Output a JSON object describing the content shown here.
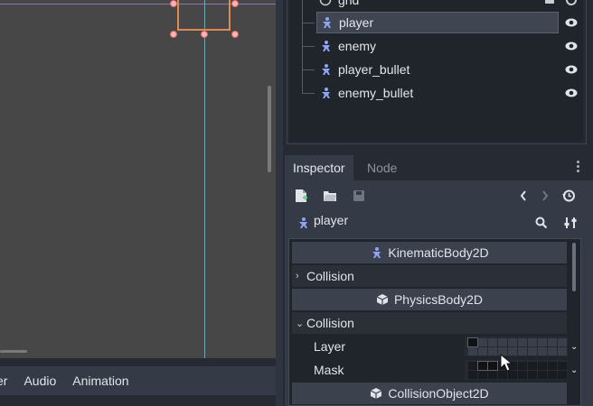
{
  "bottom_tabs": [
    "er",
    "Audio",
    "Animation"
  ],
  "scene_tree": {
    "partial_top": "grid",
    "items": [
      {
        "label": "player",
        "selected": true
      },
      {
        "label": "enemy",
        "selected": false
      },
      {
        "label": "player_bullet",
        "selected": false
      },
      {
        "label": "enemy_bullet",
        "selected": false
      }
    ]
  },
  "inspector": {
    "tabs": {
      "inspector": "Inspector",
      "node": "Node"
    },
    "object_name": "player",
    "rows": {
      "kinematic": "KinematicBody2D",
      "collision1": "Collision",
      "physics": "PhysicsBody2D",
      "collision2": "Collision",
      "layer": "Layer",
      "mask": "Mask",
      "collision_object": "CollisionObject2D"
    }
  },
  "colors": {
    "panel": "#262a33",
    "tree_bg": "#20242b",
    "viewport": "#474747",
    "accent_node": "#8da5f3",
    "selection_rect": "#e0884f"
  },
  "icons": [
    "node-kinematic-icon",
    "eye-icon",
    "new-script-icon",
    "open-icon",
    "save-icon",
    "back-icon",
    "forward-icon",
    "history-icon",
    "search-icon",
    "tools-icon",
    "box-icon"
  ]
}
